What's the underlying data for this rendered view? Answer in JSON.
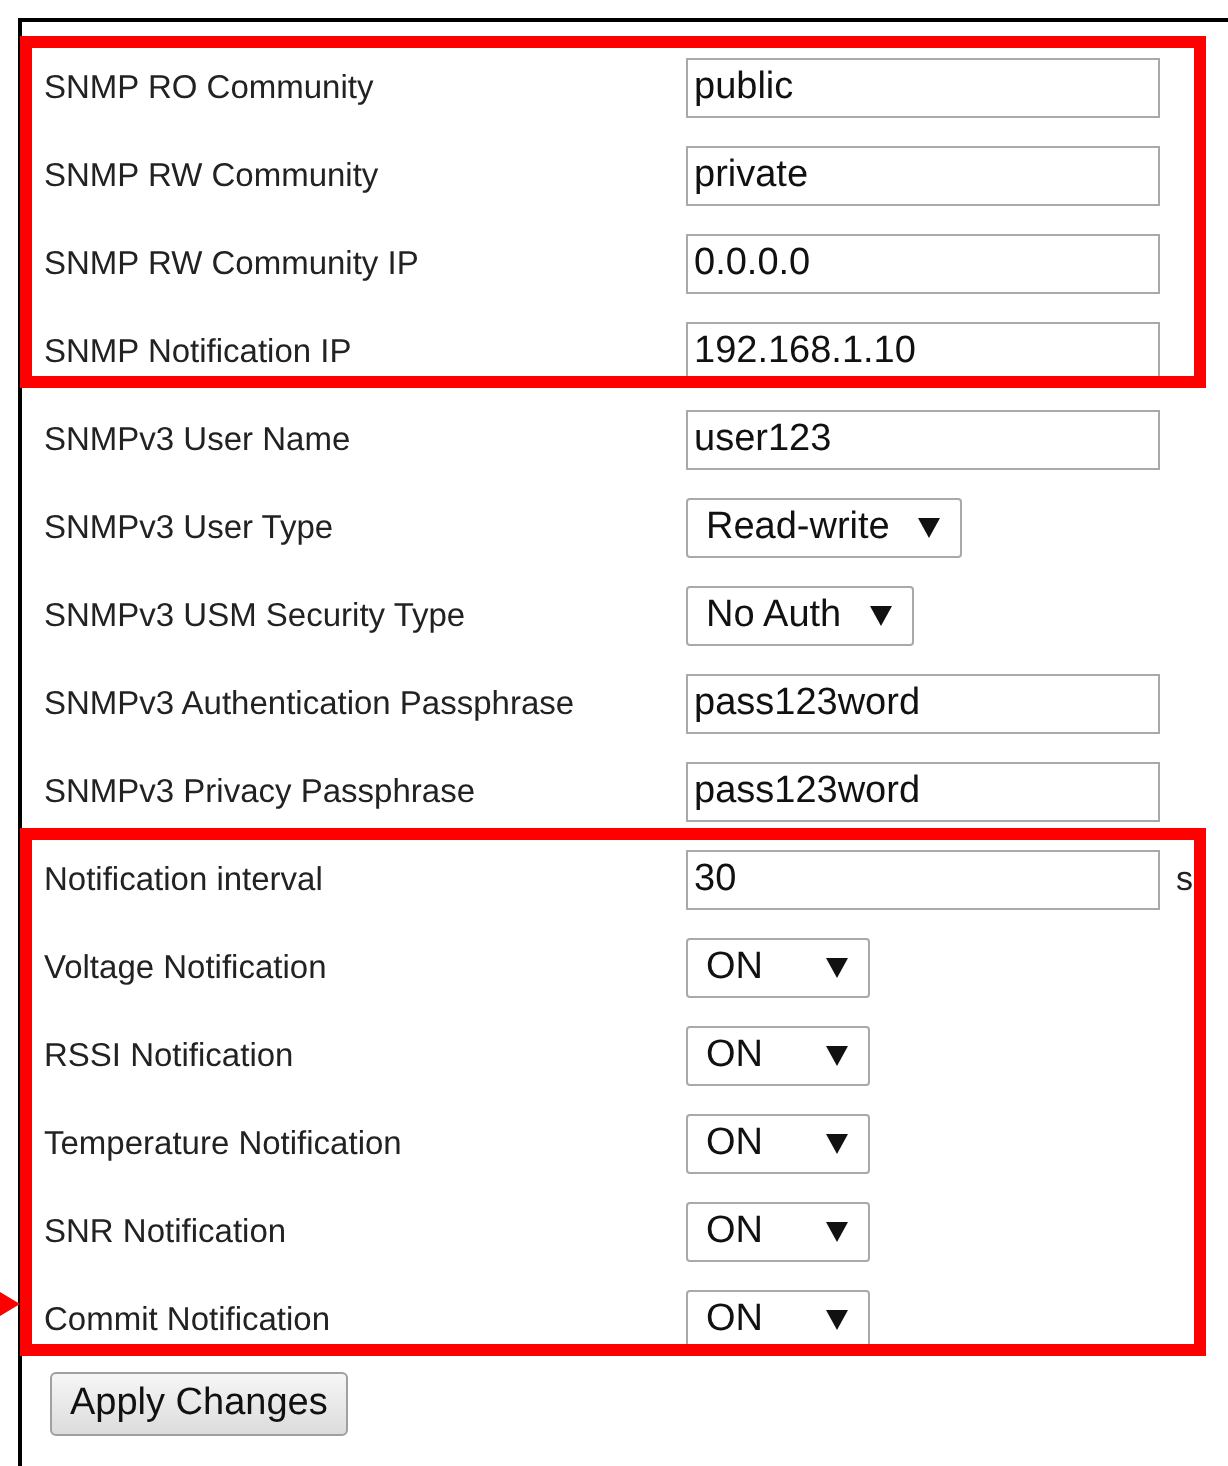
{
  "groups": [
    {
      "highlighted": true,
      "rows": [
        {
          "kind": "text",
          "label": "SNMP RO Community",
          "value": "public"
        },
        {
          "kind": "text",
          "label": "SNMP RW Community",
          "value": "private"
        },
        {
          "kind": "text",
          "label": "SNMP RW Community IP",
          "value": "0.0.0.0"
        },
        {
          "kind": "text",
          "label": "SNMP Notification IP",
          "value": "192.168.1.10"
        }
      ]
    },
    {
      "highlighted": false,
      "rows": [
        {
          "kind": "text",
          "label": "SNMPv3 User Name",
          "value": "user123"
        },
        {
          "kind": "select",
          "label": "SNMPv3 User Type",
          "value": "Read-write"
        },
        {
          "kind": "select",
          "label": "SNMPv3 USM Security Type",
          "value": "No Auth"
        },
        {
          "kind": "text",
          "label": "SNMPv3 Authentication Passphrase",
          "value": "pass123word"
        },
        {
          "kind": "text",
          "label": "SNMPv3 Privacy Passphrase",
          "value": "pass123word"
        }
      ]
    },
    {
      "highlighted": true,
      "marker_arrow": true,
      "rows": [
        {
          "kind": "text",
          "label": "Notification interval",
          "value": "30",
          "suffix": "s"
        },
        {
          "kind": "select",
          "label": "Voltage Notification",
          "value": "ON"
        },
        {
          "kind": "select",
          "label": "RSSI Notification",
          "value": "ON"
        },
        {
          "kind": "select",
          "label": "Temperature Notification",
          "value": "ON"
        },
        {
          "kind": "select",
          "label": "SNR Notification",
          "value": "ON"
        },
        {
          "kind": "select",
          "label": "Commit Notification",
          "value": "ON"
        }
      ]
    }
  ],
  "apply_button": "Apply Changes"
}
